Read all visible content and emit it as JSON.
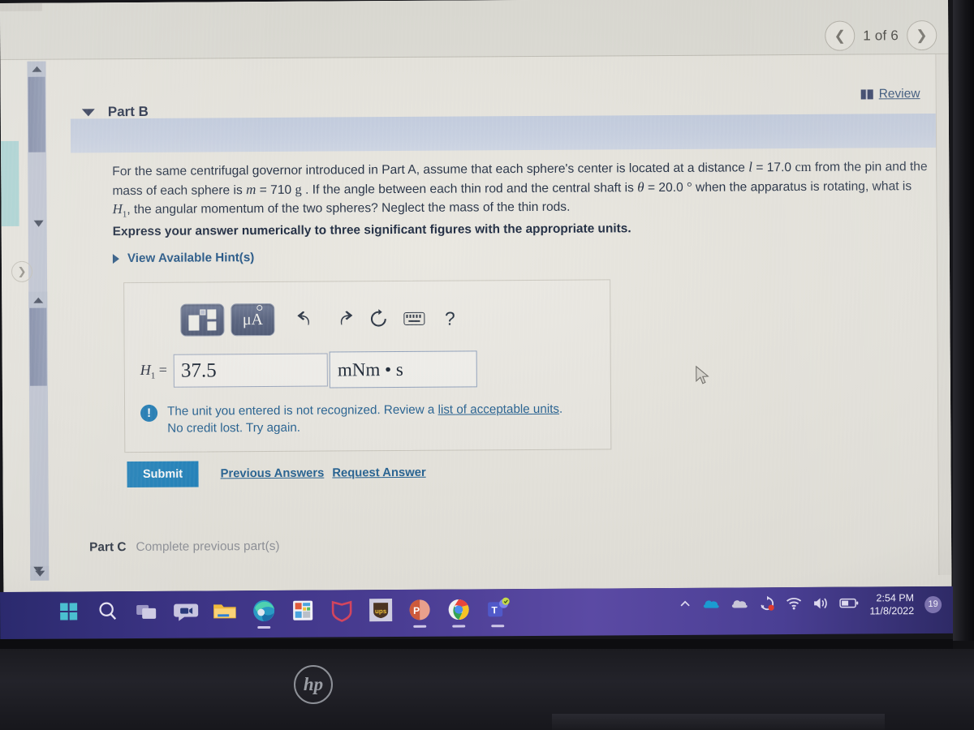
{
  "pager": {
    "prev_icon": "chevron-left-icon",
    "label": "1 of 6",
    "next_icon": "chevron-right-icon"
  },
  "review": {
    "icon": "book-icon",
    "label": "Review"
  },
  "part_b": {
    "collapse_icon": "caret-down-icon",
    "title": "Part B",
    "prompt_segments": {
      "s1": "For the same centrifugal governor introduced in Part A, assume that each sphere's center is located at a distance ",
      "var_l": "l",
      "eq1": " = 17.0 ",
      "unit_cm": "cm",
      "s2": " from the pin and the mass of each sphere is ",
      "var_m": "m",
      "eq2": " = 710 ",
      "unit_g": "g",
      "s3": " . If the angle between each thin rod and the central shaft is ",
      "var_theta": "θ",
      "eq3": " = 20.0 ",
      "unit_deg": "°",
      "s4": " when the apparatus is rotating, what is ",
      "var_h": "H",
      "var_h_sub": "1",
      "s5": ", the angular momentum of the two spheres? Neglect the mass of the thin rods."
    },
    "express_instruction": "Express your answer numerically to three significant figures with the appropriate units.",
    "hints": {
      "expand_icon": "caret-right-icon",
      "label": "View Available Hint(s)"
    },
    "toolbar": {
      "template_icon": "math-template-icon",
      "units_icon": "micro-angstrom-units-icon",
      "undo_icon": "undo-arrow-icon",
      "redo_icon": "redo-arrow-icon",
      "reset_icon": "reset-circular-arrow-icon",
      "keyboard_icon": "keyboard-icon",
      "help_icon": "question-mark-icon",
      "help_label": "?"
    },
    "answer": {
      "label_var": "H",
      "label_sub": "1",
      "label_eq": "=",
      "value": "37.5",
      "value_placeholder": "",
      "unit_value": "mNm • s",
      "unit_placeholder": ""
    },
    "feedback": {
      "icon": "exclamation-circle-icon",
      "line1_pre": "The unit you entered is not recognized. Review a ",
      "line1_link": "list of acceptable units",
      "line1_post": ".",
      "line2": "No credit lost. Try again."
    },
    "actions": {
      "submit": "Submit",
      "previous_answers": "Previous Answers",
      "request_answer": "Request Answer"
    }
  },
  "part_c": {
    "title": "Part C",
    "status": "Complete previous part(s)"
  },
  "scrollbar": {
    "up_icon": "scroll-up-arrow-icon",
    "down_icon": "scroll-down-arrow-icon",
    "side_next_icon": "chevron-right-icon"
  },
  "taskbar": {
    "items": [
      {
        "icon": "windows-start-icon"
      },
      {
        "icon": "search-icon"
      },
      {
        "icon": "task-view-icon"
      },
      {
        "icon": "chat-icon"
      },
      {
        "icon": "file-explorer-icon"
      },
      {
        "icon": "microsoft-edge-icon",
        "running": true
      },
      {
        "icon": "calculator-icon"
      },
      {
        "icon": "mcafee-icon"
      },
      {
        "icon": "ups-icon"
      },
      {
        "icon": "powerpoint-icon",
        "running": true
      },
      {
        "icon": "google-chrome-icon",
        "running": true
      },
      {
        "icon": "microsoft-teams-icon",
        "running": true
      }
    ],
    "tray": [
      {
        "icon": "show-hidden-icons-chevron-icon"
      },
      {
        "icon": "onedrive-blue-icon"
      },
      {
        "icon": "onedrive-grey-icon"
      },
      {
        "icon": "sync-error-icon"
      },
      {
        "icon": "wifi-icon"
      },
      {
        "icon": "volume-icon"
      },
      {
        "icon": "battery-icon"
      }
    ],
    "clock": {
      "time": "2:54 PM",
      "date": "11/8/2022"
    },
    "notification_badge": "19"
  },
  "laptop": {
    "brand": "hp"
  },
  "colors": {
    "accent_blue": "#1a80bc",
    "link_blue": "#1d5d90",
    "band_blue": "#c7d0e2",
    "taskbar_purple": "#4a3d93",
    "page_bg": "#e8e6df"
  }
}
